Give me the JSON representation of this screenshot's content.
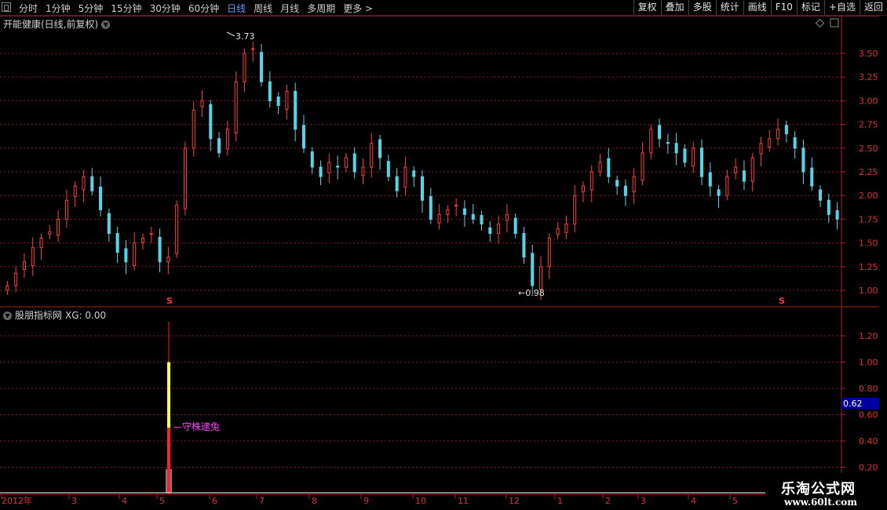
{
  "toolbar": {
    "periods": [
      "分时",
      "1分钟",
      "5分钟",
      "15分钟",
      "30分钟",
      "60分钟",
      "日线",
      "周线",
      "月线",
      "多周期",
      "更多 >"
    ],
    "active_period": "日线",
    "right_buttons": [
      "复权",
      "叠加",
      "多股",
      "统计",
      "画线",
      "F10",
      "标记",
      "+自选",
      "返回"
    ]
  },
  "main_chart": {
    "title": "开能健康(日线,前复权)",
    "high_label": "3.73",
    "low_label": "0.98",
    "signal_marker": "S",
    "y_ticks": [
      "3.50",
      "3.25",
      "3.00",
      "2.75",
      "2.50",
      "2.25",
      "2.00",
      "1.75",
      "1.50",
      "1.25",
      "1.00"
    ]
  },
  "indicator": {
    "title": "股朋指标网",
    "xg_label": "XG: 0.00",
    "annotation": "守株逮兔",
    "current_value": "0.62",
    "y_ticks": [
      "1.20",
      "1.00",
      "0.80",
      "0.60",
      "0.40",
      "0.20"
    ]
  },
  "time_axis": {
    "labels": [
      "2012年",
      "3",
      "4",
      "5",
      "6",
      "7",
      "8",
      "9",
      "10",
      "11",
      "12",
      "1",
      "2",
      "3",
      "4",
      "5"
    ]
  },
  "watermark": {
    "line1": "乐淘公式网",
    "line2": "www.60lt.com"
  },
  "colors": {
    "up": "#ff3b3b",
    "down": "#4fd8e8",
    "grid": "#8a1a1a",
    "axis": "#b01e1e",
    "active_tab": "#5aa0ff",
    "signal_bar": "#ffff33",
    "annotation": "#ff40ff",
    "value_box": "#0000a0"
  },
  "chart_data": {
    "type": "candlestick",
    "ylim": [
      0.9,
      3.8
    ],
    "key_points": [
      {
        "label": "high",
        "value": 3.73
      },
      {
        "label": "low",
        "value": 0.98
      }
    ],
    "closes": [
      1.05,
      1.18,
      1.3,
      1.45,
      1.55,
      1.62,
      1.75,
      1.95,
      2.1,
      2.2,
      2.05,
      1.85,
      1.6,
      1.4,
      1.3,
      1.5,
      1.55,
      1.6,
      1.3,
      1.35,
      1.9,
      2.5,
      2.9,
      3.0,
      2.6,
      2.45,
      2.7,
      3.2,
      3.5,
      3.55,
      3.2,
      3.0,
      2.95,
      3.1,
      2.7,
      2.5,
      2.3,
      2.2,
      2.35,
      2.3,
      2.4,
      2.25,
      2.3,
      2.55,
      2.4,
      2.2,
      2.05,
      2.3,
      2.2,
      1.95,
      1.75,
      1.8,
      1.85,
      1.9,
      1.8,
      1.75,
      1.7,
      1.6,
      1.7,
      1.8,
      1.6,
      1.35,
      1.05,
      1.25,
      1.55,
      1.65,
      1.7,
      2.0,
      2.1,
      2.25,
      2.35,
      2.2,
      2.1,
      2.0,
      2.2,
      2.45,
      2.7,
      2.6,
      2.55,
      2.45,
      2.35,
      2.5,
      2.2,
      2.1,
      2.0,
      2.2,
      2.3,
      2.15,
      2.4,
      2.55,
      2.6,
      2.7,
      2.65,
      2.5,
      2.25,
      2.1,
      1.95,
      1.8,
      1.75
    ]
  }
}
